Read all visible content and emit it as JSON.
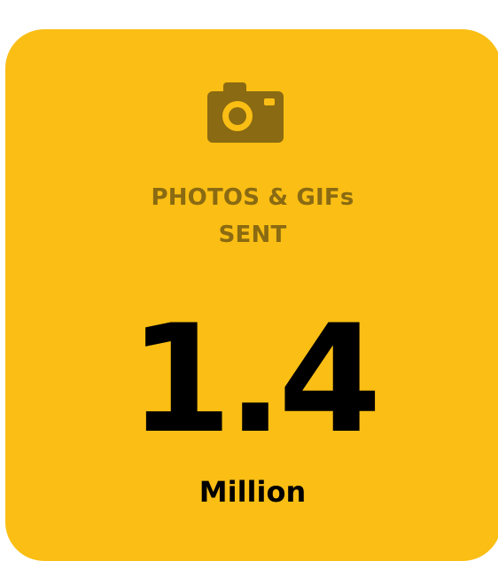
{
  "card": {
    "background": "#FABE14",
    "icon": "camera-icon",
    "title_line_1": "PHOTOS & GIFs",
    "title_line_2": "SENT",
    "value": "1.4",
    "unit": "Million"
  }
}
